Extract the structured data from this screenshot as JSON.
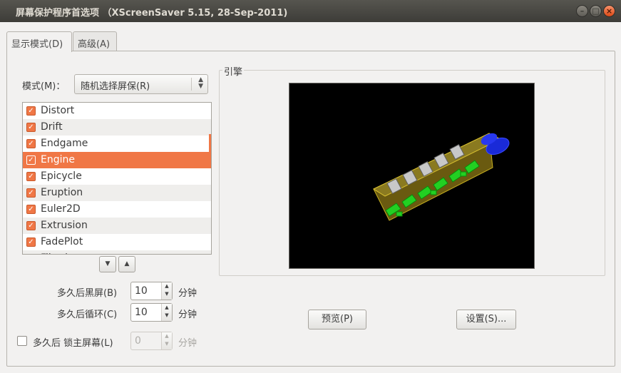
{
  "window": {
    "title": "屏幕保护程序首选项 （XScreenSaver 5.15, 28-Sep-2011)",
    "minimize": "–",
    "maximize": "□",
    "close": "×"
  },
  "tabs": [
    {
      "label": "显示模式(D)",
      "active": true
    },
    {
      "label": "高级(A)",
      "active": false
    }
  ],
  "mode": {
    "label": "模式(M)：",
    "value": "随机选择屏保(R)"
  },
  "savers": [
    {
      "name": "Distort",
      "checked": true
    },
    {
      "name": "Drift",
      "checked": true
    },
    {
      "name": "Endgame",
      "checked": true
    },
    {
      "name": "Engine",
      "checked": true,
      "selected": true
    },
    {
      "name": "Epicycle",
      "checked": true
    },
    {
      "name": "Eruption",
      "checked": true
    },
    {
      "name": "Euler2D",
      "checked": true
    },
    {
      "name": "Extrusion",
      "checked": true
    },
    {
      "name": "FadePlot",
      "checked": true
    },
    {
      "name": "Fiberlamp",
      "checked": true
    }
  ],
  "blank_after": {
    "label": "多久后黑屏(B)",
    "value": "10",
    "unit": "分钟"
  },
  "cycle_after": {
    "label": "多久后循环(C)",
    "value": "10",
    "unit": "分钟"
  },
  "lock": {
    "label": "多久后 锁主屏幕(L)",
    "value": "0",
    "unit": "分钟",
    "checked": false
  },
  "engine_frame": {
    "title": "引擎"
  },
  "buttons": {
    "preview": "预览(P)",
    "settings": "设置(S)..."
  },
  "colors": {
    "accent": "#f07746",
    "titlebar": "#3c3b37"
  }
}
